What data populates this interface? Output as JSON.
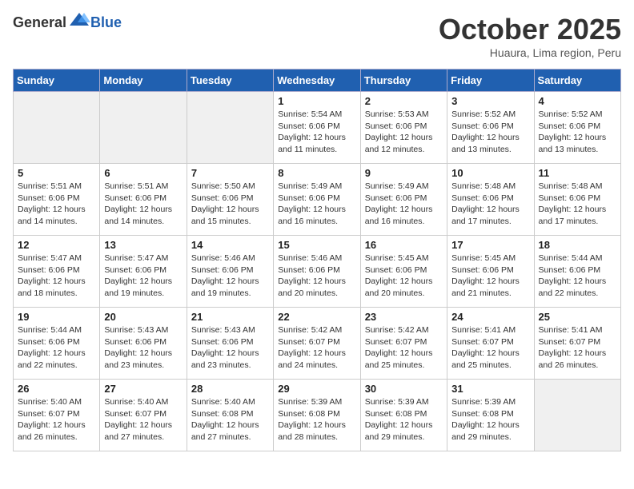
{
  "header": {
    "logo_general": "General",
    "logo_blue": "Blue",
    "month": "October 2025",
    "location": "Huaura, Lima region, Peru"
  },
  "weekdays": [
    "Sunday",
    "Monday",
    "Tuesday",
    "Wednesday",
    "Thursday",
    "Friday",
    "Saturday"
  ],
  "weeks": [
    [
      {
        "day": "",
        "info": ""
      },
      {
        "day": "",
        "info": ""
      },
      {
        "day": "",
        "info": ""
      },
      {
        "day": "1",
        "info": "Sunrise: 5:54 AM\nSunset: 6:06 PM\nDaylight: 12 hours\nand 11 minutes."
      },
      {
        "day": "2",
        "info": "Sunrise: 5:53 AM\nSunset: 6:06 PM\nDaylight: 12 hours\nand 12 minutes."
      },
      {
        "day": "3",
        "info": "Sunrise: 5:52 AM\nSunset: 6:06 PM\nDaylight: 12 hours\nand 13 minutes."
      },
      {
        "day": "4",
        "info": "Sunrise: 5:52 AM\nSunset: 6:06 PM\nDaylight: 12 hours\nand 13 minutes."
      }
    ],
    [
      {
        "day": "5",
        "info": "Sunrise: 5:51 AM\nSunset: 6:06 PM\nDaylight: 12 hours\nand 14 minutes."
      },
      {
        "day": "6",
        "info": "Sunrise: 5:51 AM\nSunset: 6:06 PM\nDaylight: 12 hours\nand 14 minutes."
      },
      {
        "day": "7",
        "info": "Sunrise: 5:50 AM\nSunset: 6:06 PM\nDaylight: 12 hours\nand 15 minutes."
      },
      {
        "day": "8",
        "info": "Sunrise: 5:49 AM\nSunset: 6:06 PM\nDaylight: 12 hours\nand 16 minutes."
      },
      {
        "day": "9",
        "info": "Sunrise: 5:49 AM\nSunset: 6:06 PM\nDaylight: 12 hours\nand 16 minutes."
      },
      {
        "day": "10",
        "info": "Sunrise: 5:48 AM\nSunset: 6:06 PM\nDaylight: 12 hours\nand 17 minutes."
      },
      {
        "day": "11",
        "info": "Sunrise: 5:48 AM\nSunset: 6:06 PM\nDaylight: 12 hours\nand 17 minutes."
      }
    ],
    [
      {
        "day": "12",
        "info": "Sunrise: 5:47 AM\nSunset: 6:06 PM\nDaylight: 12 hours\nand 18 minutes."
      },
      {
        "day": "13",
        "info": "Sunrise: 5:47 AM\nSunset: 6:06 PM\nDaylight: 12 hours\nand 19 minutes."
      },
      {
        "day": "14",
        "info": "Sunrise: 5:46 AM\nSunset: 6:06 PM\nDaylight: 12 hours\nand 19 minutes."
      },
      {
        "day": "15",
        "info": "Sunrise: 5:46 AM\nSunset: 6:06 PM\nDaylight: 12 hours\nand 20 minutes."
      },
      {
        "day": "16",
        "info": "Sunrise: 5:45 AM\nSunset: 6:06 PM\nDaylight: 12 hours\nand 20 minutes."
      },
      {
        "day": "17",
        "info": "Sunrise: 5:45 AM\nSunset: 6:06 PM\nDaylight: 12 hours\nand 21 minutes."
      },
      {
        "day": "18",
        "info": "Sunrise: 5:44 AM\nSunset: 6:06 PM\nDaylight: 12 hours\nand 22 minutes."
      }
    ],
    [
      {
        "day": "19",
        "info": "Sunrise: 5:44 AM\nSunset: 6:06 PM\nDaylight: 12 hours\nand 22 minutes."
      },
      {
        "day": "20",
        "info": "Sunrise: 5:43 AM\nSunset: 6:06 PM\nDaylight: 12 hours\nand 23 minutes."
      },
      {
        "day": "21",
        "info": "Sunrise: 5:43 AM\nSunset: 6:06 PM\nDaylight: 12 hours\nand 23 minutes."
      },
      {
        "day": "22",
        "info": "Sunrise: 5:42 AM\nSunset: 6:07 PM\nDaylight: 12 hours\nand 24 minutes."
      },
      {
        "day": "23",
        "info": "Sunrise: 5:42 AM\nSunset: 6:07 PM\nDaylight: 12 hours\nand 25 minutes."
      },
      {
        "day": "24",
        "info": "Sunrise: 5:41 AM\nSunset: 6:07 PM\nDaylight: 12 hours\nand 25 minutes."
      },
      {
        "day": "25",
        "info": "Sunrise: 5:41 AM\nSunset: 6:07 PM\nDaylight: 12 hours\nand 26 minutes."
      }
    ],
    [
      {
        "day": "26",
        "info": "Sunrise: 5:40 AM\nSunset: 6:07 PM\nDaylight: 12 hours\nand 26 minutes."
      },
      {
        "day": "27",
        "info": "Sunrise: 5:40 AM\nSunset: 6:07 PM\nDaylight: 12 hours\nand 27 minutes."
      },
      {
        "day": "28",
        "info": "Sunrise: 5:40 AM\nSunset: 6:08 PM\nDaylight: 12 hours\nand 27 minutes."
      },
      {
        "day": "29",
        "info": "Sunrise: 5:39 AM\nSunset: 6:08 PM\nDaylight: 12 hours\nand 28 minutes."
      },
      {
        "day": "30",
        "info": "Sunrise: 5:39 AM\nSunset: 6:08 PM\nDaylight: 12 hours\nand 29 minutes."
      },
      {
        "day": "31",
        "info": "Sunrise: 5:39 AM\nSunset: 6:08 PM\nDaylight: 12 hours\nand 29 minutes."
      },
      {
        "day": "",
        "info": ""
      }
    ]
  ]
}
